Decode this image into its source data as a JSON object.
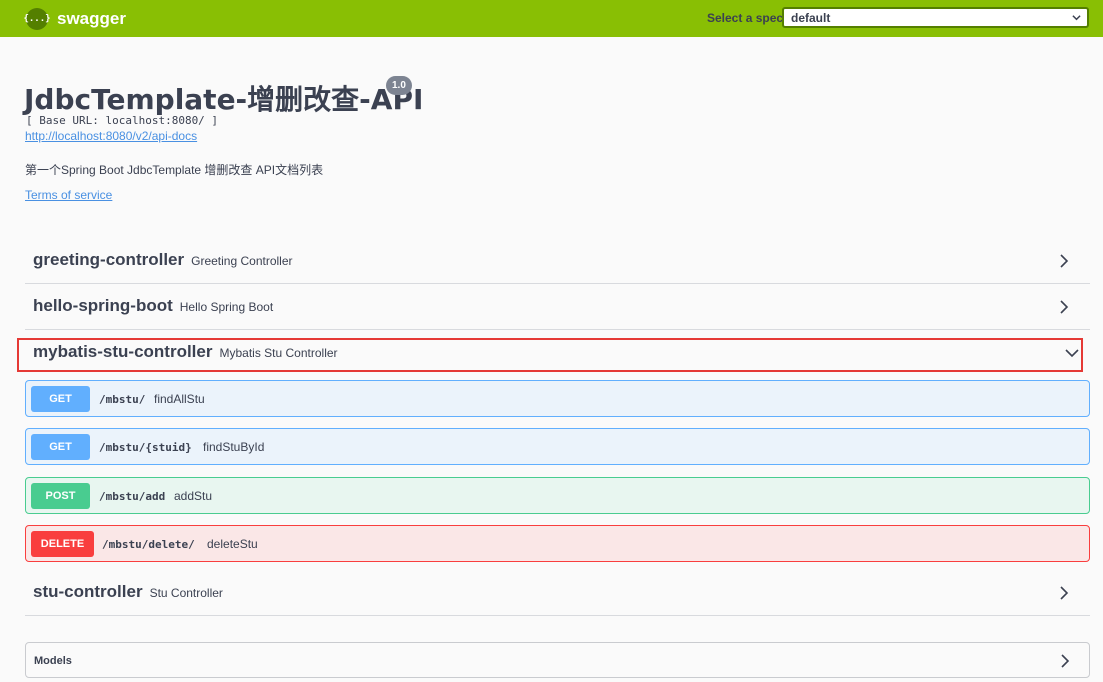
{
  "topbar": {
    "logo_icon": "{...}",
    "logo_text": "swagger",
    "select_label": "Select a spec",
    "select_value": "default"
  },
  "info": {
    "title": "JdbcTemplate-增删改查-API",
    "version": "1.0",
    "base_url": "[ Base URL: localhost:8080/ ]",
    "api_docs_url": "http://localhost:8080/v2/api-docs",
    "description": "第一个Spring Boot JdbcTemplate 增删改查 API文档列表",
    "terms_of_service": "Terms of service"
  },
  "tags": [
    {
      "name": "greeting-controller",
      "description": "Greeting Controller",
      "expanded": false
    },
    {
      "name": "hello-spring-boot",
      "description": "Hello Spring Boot",
      "expanded": false
    },
    {
      "name": "mybatis-stu-controller",
      "description": "Mybatis Stu Controller",
      "expanded": true
    },
    {
      "name": "stu-controller",
      "description": "Stu Controller",
      "expanded": false
    }
  ],
  "operations": [
    {
      "method": "GET",
      "path": "/mbstu/",
      "summary": "findAllStu"
    },
    {
      "method": "GET",
      "path": "/mbstu/{stuid}",
      "summary": "findStuById"
    },
    {
      "method": "POST",
      "path": "/mbstu/add",
      "summary": "addStu"
    },
    {
      "method": "DELETE",
      "path": "/mbstu/delete/",
      "summary": "deleteStu"
    }
  ],
  "models": {
    "title": "Models"
  },
  "colors": {
    "topbar": "#89bf04",
    "get": "#61affe",
    "post": "#49cc90",
    "delete": "#f93e3e",
    "link": "#4990e2",
    "highlight": "#e53935"
  }
}
